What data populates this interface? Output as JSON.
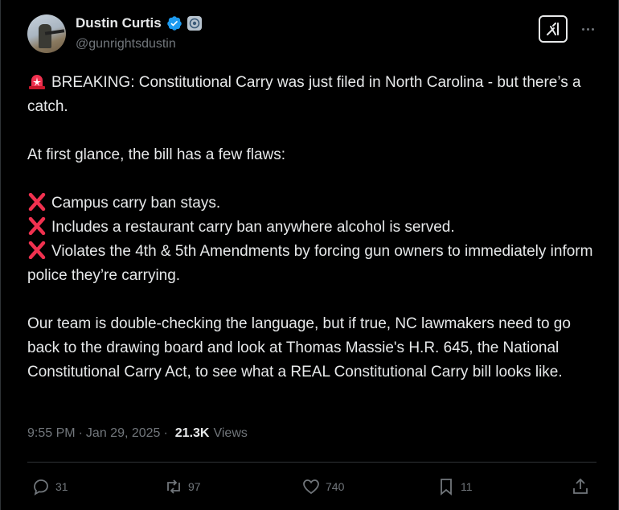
{
  "author": {
    "name": "Dustin Curtis",
    "handle": "@gunrightsdustin"
  },
  "tweet": {
    "line1": "BREAKING: Constitutional Carry was just filed in North Carolina - but there’s a catch.",
    "line2": "At first glance, the bill has a few flaws:",
    "flaws": [
      "Campus carry ban stays.",
      "Includes a restaurant carry ban anywhere alcohol is served.",
      "Violates the 4th & 5th Amendments by forcing gun owners to immediately inform police they’re carrying."
    ],
    "closing": "Our team is double-checking the language, but if true, NC lawmakers need to go back to the drawing board and look at Thomas Massie's H.R. 645, the National Constitutional Carry Act, to see what a REAL Constitutional Carry bill looks like."
  },
  "meta": {
    "time": "9:55 PM",
    "date": "Jan 29, 2025",
    "separator": "·",
    "views_count": "21.3K",
    "views_label": "Views"
  },
  "actions": {
    "replies": "31",
    "reposts": "97",
    "likes": "740",
    "bookmarks": "11"
  },
  "icons": {
    "verified": "verified-check-icon",
    "siren": "police-siren-icon",
    "cross": "red-cross-icon"
  },
  "colors": {
    "verified_blue": "#1d9bf0",
    "muted": "#71767b",
    "cross_red": "#f0314f"
  }
}
